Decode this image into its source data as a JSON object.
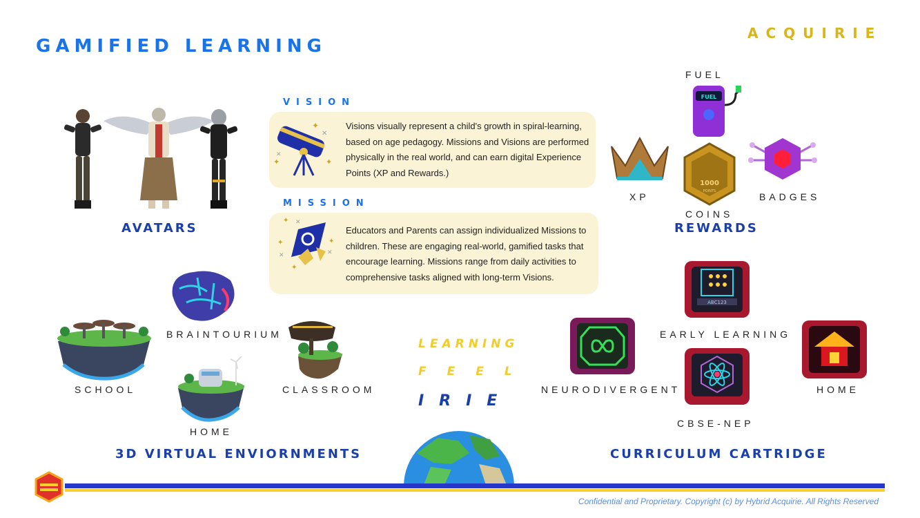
{
  "header": {
    "title": "GAMIFIED LEARNING",
    "brand": "ACQUIRIE"
  },
  "avatars": {
    "label": "AVATARS"
  },
  "vision": {
    "heading": "VISION",
    "text": "Visions visually represent a child's growth in spiral-learning, based on age pedagogy. Missions and Visions are performed physically in the real world, and can earn digital Experience Points (XP and Rewards.)"
  },
  "mission": {
    "heading": "MISSION",
    "text": "Educators and Parents can assign individualized Missions to children. These are engaging real-world, gamified tasks that encourage learning. Missions range from daily activities to comprehensive tasks aligned with long-term Visions."
  },
  "rewards": {
    "fuel": "FUEL",
    "fuel_sign": "FUEL",
    "xp": "XP",
    "coins": "COINS",
    "coin_value": "1000",
    "coin_unit": "POINTS",
    "badges": "BADGES",
    "section": "REWARDS"
  },
  "environments": {
    "braintourium": "BRAINTOURIUM",
    "school": "SCHOOL",
    "home": "HOME",
    "classroom": "CLASSROOM",
    "section": "3D VIRTUAL ENVIORNMENTS"
  },
  "tagline": {
    "line1": "LEARNING",
    "line2": "FEEL",
    "line3": "IRIE"
  },
  "curriculum": {
    "early_learning": "EARLY LEARNING",
    "early_keys": "ABC123",
    "neurodivergent": "NEURODIVERGENT",
    "cbse": "CBSE-NEP",
    "home": "HOME",
    "section": "CURRICULUM CARTRIDGE"
  },
  "footer": {
    "copyright": "Confidential and Proprietary. Copyright (c) by Hybrid Acquirie. All Rights Reserved"
  },
  "colors": {
    "brand_blue": "#1a73e8",
    "section_blue": "#1a3fa8",
    "gold": "#d9b51a",
    "tagline_yellow": "#f2cd2a",
    "card_bg": "#fbf3d5",
    "bar_blue": "#2637c9",
    "bar_yellow": "#f5cf2a"
  }
}
